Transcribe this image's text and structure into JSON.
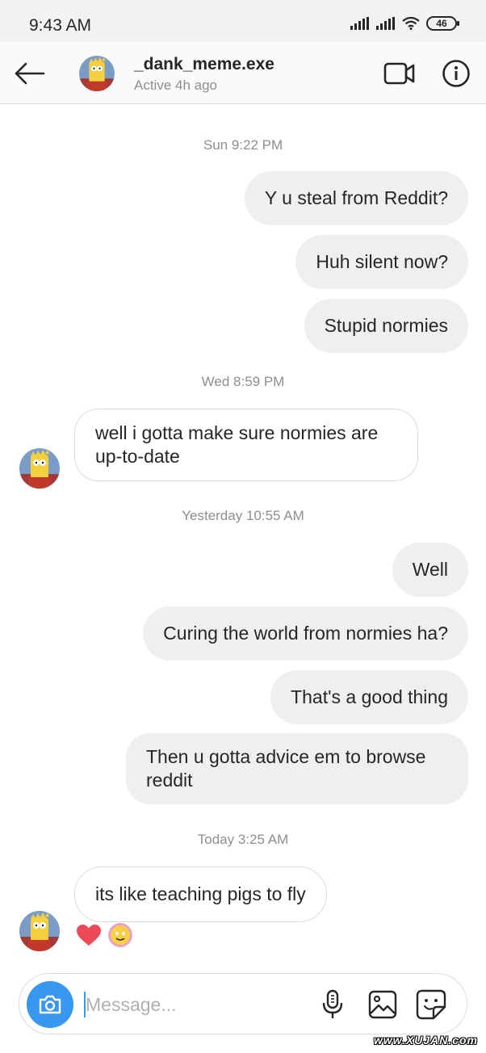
{
  "status_bar": {
    "time": "9:43 AM",
    "battery": "46"
  },
  "header": {
    "contact_name": "_dank_meme.exe",
    "contact_status": "Active 4h ago"
  },
  "conversation": {
    "groups": [
      {
        "timestamp": "Sun 9:22 PM",
        "messages": [
          {
            "sender": "me",
            "text": "Y u steal from Reddit?"
          },
          {
            "sender": "me",
            "text": "Huh silent now?"
          },
          {
            "sender": "me",
            "text": "Stupid normies"
          }
        ]
      },
      {
        "timestamp": "Wed 8:59 PM",
        "messages": [
          {
            "sender": "them",
            "text": "well i gotta make sure normies are up-to-date"
          }
        ]
      },
      {
        "timestamp": "Yesterday 10:55 AM",
        "messages": [
          {
            "sender": "me",
            "text": "Well"
          },
          {
            "sender": "me",
            "text": "Curing the world from normies ha?"
          },
          {
            "sender": "me",
            "text": "That's a good thing"
          },
          {
            "sender": "me",
            "text": "Then u gotta advice em to browse reddit"
          }
        ]
      },
      {
        "timestamp": "Today 3:25 AM",
        "messages": [
          {
            "sender": "them",
            "text": "its like teaching pigs to fly",
            "reactions": [
              "heart-emoji",
              "reactor-avatar"
            ]
          }
        ]
      }
    ]
  },
  "composer": {
    "placeholder": "Message..."
  },
  "watermark": "www.XUJAN.com",
  "colors": {
    "accent": "#3897f0",
    "outgoing_bubble": "#efefef",
    "heart": "#ed4956",
    "muted_text": "#8e8e8e"
  },
  "icons": [
    "back-arrow-icon",
    "video-call-icon",
    "info-icon",
    "camera-icon",
    "microphone-icon",
    "gallery-icon",
    "sticker-icon",
    "signal-icon",
    "wifi-icon",
    "battery-icon"
  ]
}
